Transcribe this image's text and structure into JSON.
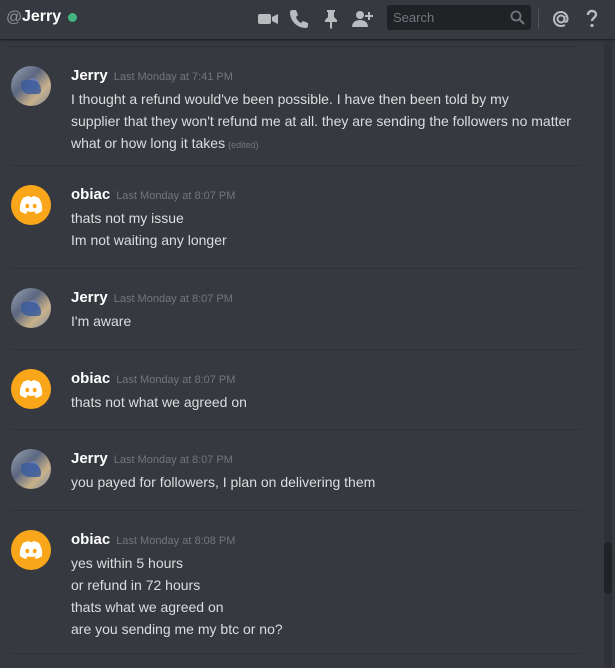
{
  "header": {
    "at_symbol": "@",
    "channel_name": "Jerry",
    "status_color": "#43b581",
    "icons": [
      "video-icon",
      "phone-icon",
      "pin-icon",
      "add-friend-icon",
      "mention-icon",
      "help-icon"
    ],
    "search": {
      "placeholder": "Search",
      "value": ""
    }
  },
  "messages": [
    {
      "author": "Jerry",
      "timestamp": "Last Monday at 7:41 PM",
      "avatar": "jerry-avatar",
      "lines": [
        "I thought a refund would've been possible. I have then been told by my",
        "supplier that they won't refund me at all. they are sending the followers no matter",
        "what or how long it takes"
      ],
      "edited_label": "(edited)"
    },
    {
      "author": "obiac",
      "timestamp": "Last Monday at 8:07 PM",
      "avatar": "discord-logo-avatar",
      "lines": [
        "thats not my issue",
        "Im not waiting any longer"
      ]
    },
    {
      "author": "Jerry",
      "timestamp": "Last Monday at 8:07 PM",
      "avatar": "jerry-avatar",
      "lines": [
        "I'm aware"
      ]
    },
    {
      "author": "obiac",
      "timestamp": "Last Monday at 8:07 PM",
      "avatar": "discord-logo-avatar",
      "lines": [
        "thats not what we agreed on"
      ]
    },
    {
      "author": "Jerry",
      "timestamp": "Last Monday at 8:07 PM",
      "avatar": "jerry-avatar",
      "lines": [
        "you payed for followers, I plan on delivering them"
      ]
    },
    {
      "author": "obiac",
      "timestamp": "Last Monday at 8:08 PM",
      "avatar": "discord-logo-avatar",
      "lines": [
        "yes within 5 hours",
        "or refund in 72 hours",
        "thats what we agreed on",
        "are you sending me my btc or no?"
      ]
    }
  ],
  "colors": {
    "background": "#36393f",
    "obiac_avatar": "#faa61a",
    "text": "#dcddde",
    "timestamp": "#72767d"
  }
}
